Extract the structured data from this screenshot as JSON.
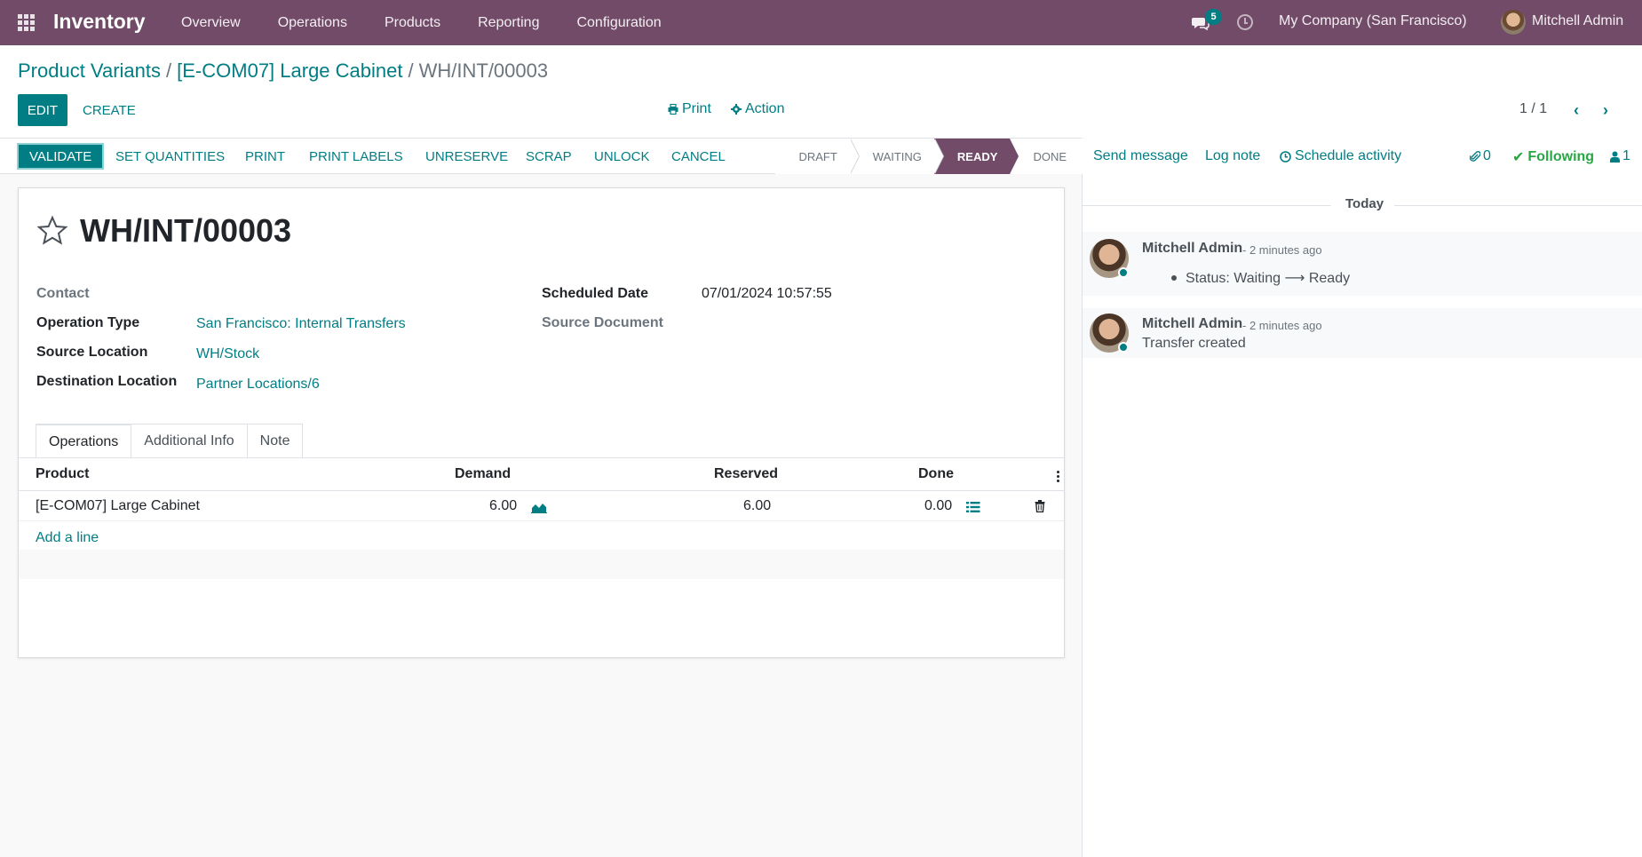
{
  "navbar": {
    "app_name": "Inventory",
    "menu": [
      "Overview",
      "Operations",
      "Products",
      "Reporting",
      "Configuration"
    ],
    "chat_count": "5",
    "company": "My Company (San Francisco)",
    "user": "Mitchell Admin"
  },
  "breadcrumb": {
    "items": [
      "Product Variants",
      "[E-COM07] Large Cabinet"
    ],
    "current": "WH/INT/00003"
  },
  "control": {
    "edit": "EDIT",
    "create": "CREATE",
    "print": "Print",
    "action": "Action",
    "pager": "1 / 1"
  },
  "statusbar": {
    "buttons": [
      "VALIDATE",
      "SET QUANTITIES",
      "PRINT",
      "PRINT LABELS",
      "UNRESERVE",
      "SCRAP",
      "UNLOCK",
      "CANCEL"
    ],
    "stages": [
      "DRAFT",
      "WAITING",
      "READY",
      "DONE"
    ],
    "active_stage": "READY"
  },
  "record": {
    "title": "WH/INT/00003",
    "left_fields": [
      {
        "label": "Contact",
        "value": ""
      },
      {
        "label": "Operation Type",
        "value": "San Francisco: Internal Transfers"
      },
      {
        "label": "Source Location",
        "value": "WH/Stock"
      },
      {
        "label": "Destination Location",
        "value": "Partner Locations/6"
      }
    ],
    "right_fields": [
      {
        "label": "Scheduled Date",
        "value": "07/01/2024 10:57:55"
      },
      {
        "label": "Source Document",
        "value": ""
      }
    ]
  },
  "tabs": [
    "Operations",
    "Additional Info",
    "Note"
  ],
  "table": {
    "headers": [
      "Product",
      "Demand",
      "Reserved",
      "Done"
    ],
    "rows": [
      {
        "product": "[E-COM07] Large Cabinet",
        "demand": "6.00",
        "reserved": "6.00",
        "done": "0.00"
      }
    ],
    "add_line": "Add a line"
  },
  "chatter": {
    "send_message": "Send message",
    "log_note": "Log note",
    "schedule_activity": "Schedule activity",
    "attachments": "0",
    "following": "Following",
    "followers": "1",
    "date_separator": "Today",
    "messages": [
      {
        "author": "Mitchell Admin",
        "time": "- 2 minutes ago",
        "body": "Status: Waiting ⟶ Ready"
      },
      {
        "author": "Mitchell Admin",
        "time": "- 2 minutes ago",
        "body": "Transfer created"
      }
    ]
  },
  "colors": {
    "brand": "#714B67",
    "accent": "#017e84"
  }
}
